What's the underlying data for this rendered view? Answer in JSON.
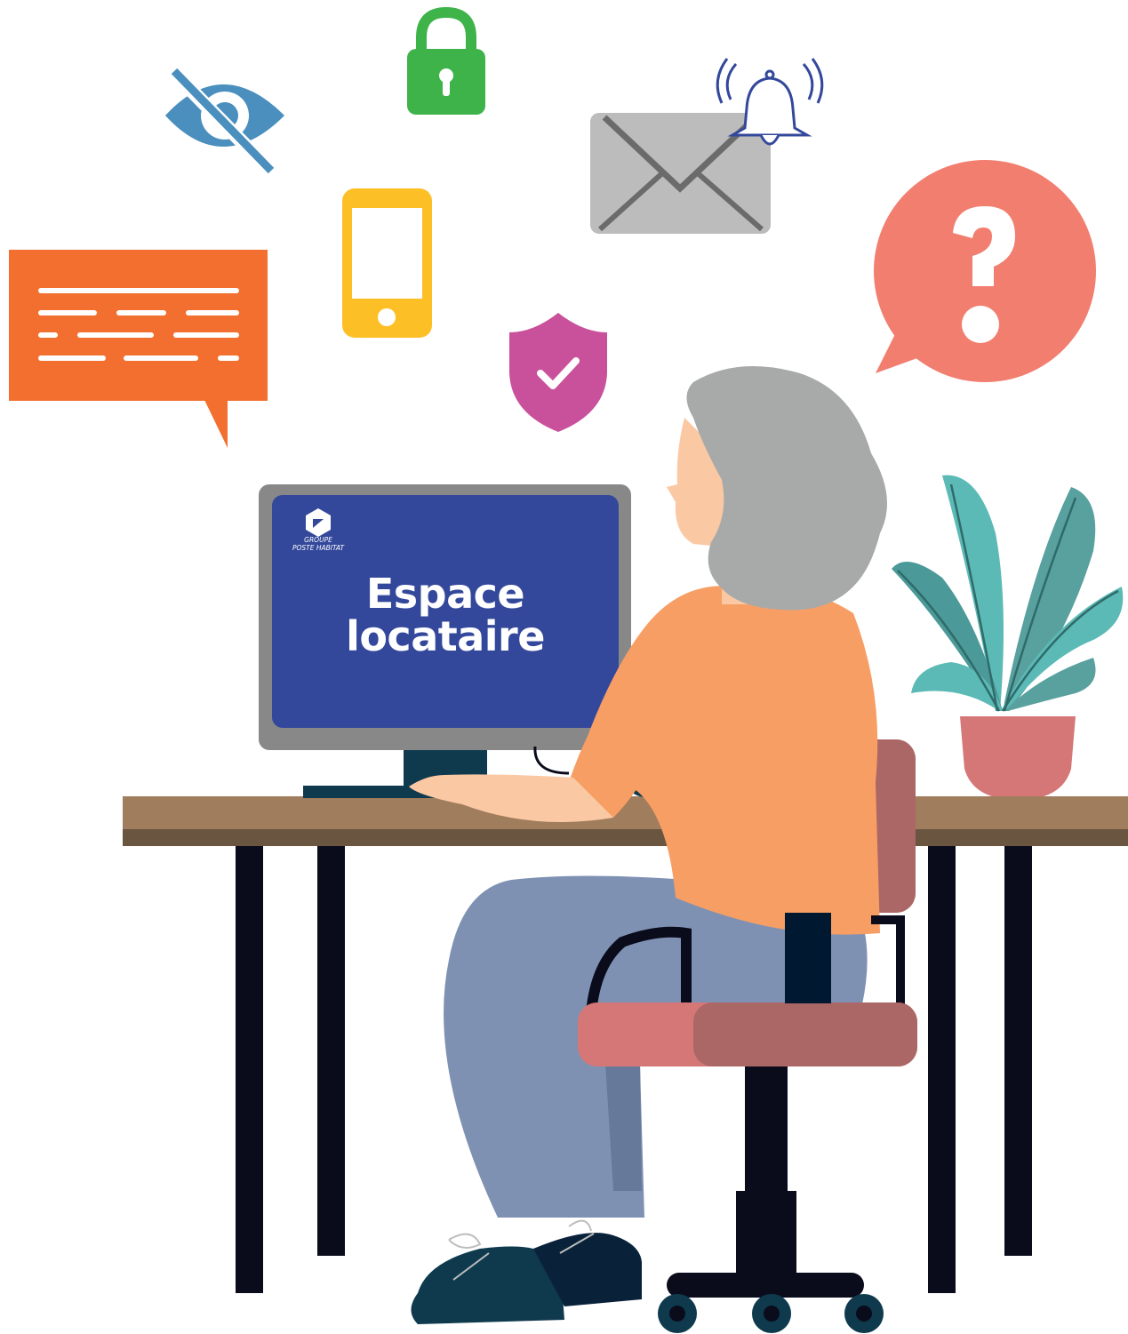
{
  "screen": {
    "logo_line1": "GROUPE",
    "logo_line2": "POSTE HABITAT",
    "title_line1": "Espace",
    "title_line2": "locataire"
  },
  "icons": [
    "eye-slash-icon",
    "padlock-icon",
    "bell-icon",
    "envelope-icon",
    "phone-icon",
    "shield-check-icon",
    "chat-bubble-icon",
    "question-bubble-icon"
  ],
  "colors": {
    "screen_blue": "#33489b",
    "orange_bubble": "#f26f2f",
    "question_bubble": "#f27e6f",
    "lock_green": "#3db34a",
    "phone_yellow": "#fdbf26",
    "shield_pink": "#c9519b",
    "eye_blue": "#4a8fbd"
  }
}
